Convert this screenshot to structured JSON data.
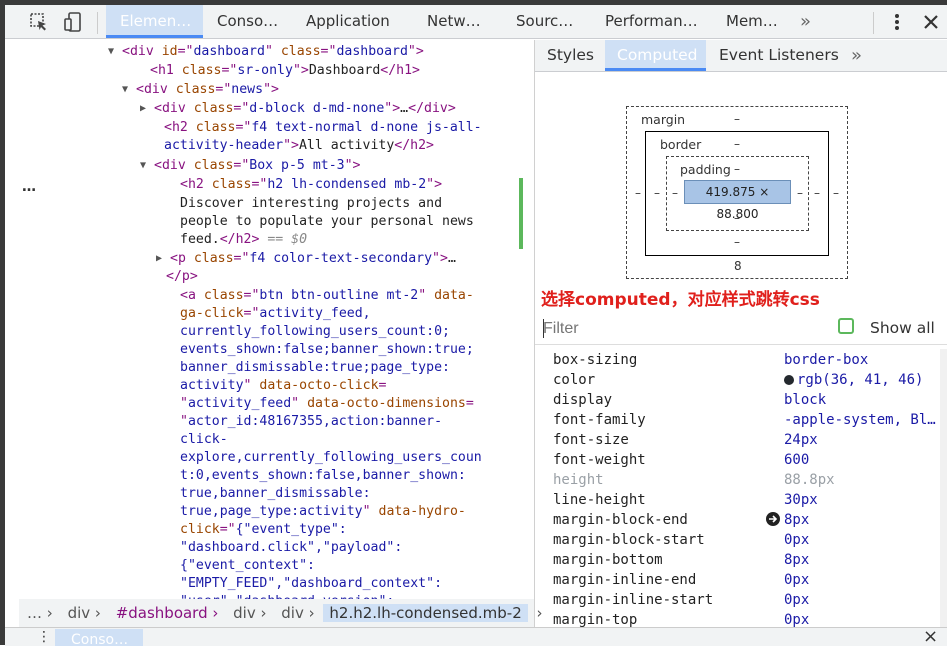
{
  "toolbar": {
    "tabs": [
      "Elemen…",
      "Conso…",
      "Application",
      "Netw…",
      "Sourc…",
      "Performan…",
      "Mem…"
    ],
    "more_label": "»"
  },
  "tree": {
    "lines": [
      [
        {
          "c": "tag",
          "t": "<div "
        },
        {
          "c": "attr",
          "t": "id"
        },
        {
          "c": "tag",
          "t": "=\""
        },
        {
          "c": "val",
          "t": "dashboard"
        },
        {
          "c": "tag",
          "t": "\" "
        },
        {
          "c": "attr",
          "t": "class"
        },
        {
          "c": "tag",
          "t": "=\""
        },
        {
          "c": "val",
          "t": "dashboard"
        },
        {
          "c": "tag",
          "t": "\">"
        }
      ],
      [
        {
          "c": "tag",
          "t": "<h1 "
        },
        {
          "c": "attr",
          "t": "class"
        },
        {
          "c": "tag",
          "t": "=\""
        },
        {
          "c": "val",
          "t": "sr-only"
        },
        {
          "c": "tag",
          "t": "\">"
        },
        {
          "c": "txt",
          "t": "Dashboard"
        },
        {
          "c": "tag",
          "t": "</h1>"
        }
      ],
      [
        {
          "c": "tag",
          "t": "<div "
        },
        {
          "c": "attr",
          "t": "class"
        },
        {
          "c": "tag",
          "t": "=\""
        },
        {
          "c": "val",
          "t": "news"
        },
        {
          "c": "tag",
          "t": "\">"
        }
      ],
      [
        {
          "c": "tag",
          "t": "<div "
        },
        {
          "c": "attr",
          "t": "class"
        },
        {
          "c": "tag",
          "t": "=\""
        },
        {
          "c": "val",
          "t": "d-block d-md-none"
        },
        {
          "c": "tag",
          "t": "\">"
        },
        {
          "c": "txt",
          "t": "…"
        },
        {
          "c": "tag",
          "t": "</div>"
        }
      ],
      [
        {
          "c": "tag",
          "t": "<h2 "
        },
        {
          "c": "attr",
          "t": "class"
        },
        {
          "c": "tag",
          "t": "=\""
        },
        {
          "c": "val",
          "t": "f4 text-normal d-none js-all-"
        }
      ],
      [
        {
          "c": "val",
          "t": "activity-header"
        },
        {
          "c": "tag",
          "t": "\">"
        },
        {
          "c": "txt",
          "t": "All activity"
        },
        {
          "c": "tag",
          "t": "</h2>"
        }
      ],
      [
        {
          "c": "tag",
          "t": "<div "
        },
        {
          "c": "attr",
          "t": "class"
        },
        {
          "c": "tag",
          "t": "=\""
        },
        {
          "c": "val",
          "t": "Box p-5 mt-3"
        },
        {
          "c": "tag",
          "t": "\">"
        }
      ],
      [
        {
          "c": "tag",
          "t": "<h2 "
        },
        {
          "c": "attr",
          "t": "class"
        },
        {
          "c": "tag",
          "t": "=\""
        },
        {
          "c": "val",
          "t": "h2 lh-condensed mb-2"
        },
        {
          "c": "tag",
          "t": "\">"
        }
      ],
      [
        {
          "c": "txt",
          "t": "Discover interesting projects and"
        }
      ],
      [
        {
          "c": "txt",
          "t": "people to populate your personal news"
        }
      ],
      [
        {
          "c": "txt",
          "t": "feed."
        },
        {
          "c": "tag",
          "t": "</h2>"
        },
        {
          "c": "dim",
          "t": " == $0"
        }
      ],
      [
        {
          "c": "tag",
          "t": "<p "
        },
        {
          "c": "attr",
          "t": "class"
        },
        {
          "c": "tag",
          "t": "=\""
        },
        {
          "c": "val",
          "t": "f4 color-text-secondary"
        },
        {
          "c": "tag",
          "t": "\">"
        },
        {
          "c": "txt",
          "t": "…"
        }
      ],
      [
        {
          "c": "tag",
          "t": "</p>"
        }
      ],
      [
        {
          "c": "tag",
          "t": "<a "
        },
        {
          "c": "attr",
          "t": "class"
        },
        {
          "c": "tag",
          "t": "=\""
        },
        {
          "c": "val",
          "t": "btn btn-outline mt-2"
        },
        {
          "c": "tag",
          "t": "\" "
        },
        {
          "c": "attr",
          "t": "data-"
        }
      ],
      [
        {
          "c": "attr",
          "t": "ga-click"
        },
        {
          "c": "tag",
          "t": "=\""
        },
        {
          "c": "val",
          "t": "activity_feed,"
        }
      ],
      [
        {
          "c": "val",
          "t": "currently_following_users_count:0;"
        }
      ],
      [
        {
          "c": "val",
          "t": "events_shown:false;banner_shown:true;"
        }
      ],
      [
        {
          "c": "val",
          "t": "banner_dismissable:true;page_type:"
        }
      ],
      [
        {
          "c": "val",
          "t": "activity"
        },
        {
          "c": "tag",
          "t": "\" "
        },
        {
          "c": "attr",
          "t": "data-octo-click"
        },
        {
          "c": "tag",
          "t": "="
        }
      ],
      [
        {
          "c": "tag",
          "t": "\""
        },
        {
          "c": "val",
          "t": "activity_feed"
        },
        {
          "c": "tag",
          "t": "\" "
        },
        {
          "c": "attr",
          "t": "data-octo-dimensions"
        },
        {
          "c": "tag",
          "t": "="
        }
      ],
      [
        {
          "c": "tag",
          "t": "\""
        },
        {
          "c": "val",
          "t": "actor_id:48167355,action:banner-"
        }
      ],
      [
        {
          "c": "val",
          "t": "click-"
        }
      ],
      [
        {
          "c": "val",
          "t": "explore,currently_following_users_coun"
        }
      ],
      [
        {
          "c": "val",
          "t": "t:0,events_shown:false,banner_shown:"
        }
      ],
      [
        {
          "c": "val",
          "t": "true,banner_dismissable:"
        }
      ],
      [
        {
          "c": "val",
          "t": "true,page_type:activity"
        },
        {
          "c": "tag",
          "t": "\" "
        },
        {
          "c": "attr",
          "t": "data-hydro-"
        }
      ],
      [
        {
          "c": "attr",
          "t": "click"
        },
        {
          "c": "tag",
          "t": "=\""
        },
        {
          "c": "val",
          "t": "{\"event_type\":"
        }
      ],
      [
        {
          "c": "val",
          "t": "\"dashboard.click\",\"payload\":"
        }
      ],
      [
        {
          "c": "val",
          "t": "{\"event_context\":"
        }
      ],
      [
        {
          "c": "val",
          "t": "\"EMPTY_FEED\",\"dashboard_context\":"
        }
      ],
      [
        {
          "c": "val",
          "t": "\"user\",\"dashboard_version\":"
        }
      ]
    ],
    "ellipsis": "…"
  },
  "breadcrumb": {
    "items": [
      "… ›",
      "div ›",
      "#dashboard ›",
      "div ›",
      "div ›"
    ],
    "selected": "h2.h2.lh-condensed.mb-2",
    "trailing": "›"
  },
  "drawer": {
    "tab": "Conso…",
    "close": "×"
  },
  "subtabs": {
    "tabs": [
      "Styles",
      "Computed",
      "Event Listeners"
    ],
    "more": "»"
  },
  "boxmodel": {
    "margin_label": "margin",
    "border_label": "border",
    "padding_label": "padding",
    "content_size": "419.875 × 88.800",
    "dash": "–",
    "margin_bottom": "8"
  },
  "annotation": "选择computed，对应样式跳转css",
  "filter": {
    "placeholder": "Filter",
    "show_all_label": "Show all"
  },
  "computed": {
    "props": [
      {
        "name": "box-sizing",
        "value": "border-box"
      },
      {
        "name": "color",
        "value": "rgb(36, 41, 46)"
      },
      {
        "name": "display",
        "value": "block"
      },
      {
        "name": "font-family",
        "value": "-apple-system, Bl…"
      },
      {
        "name": "font-size",
        "value": "24px"
      },
      {
        "name": "font-weight",
        "value": "600"
      },
      {
        "name": "height",
        "value": "88.8px"
      },
      {
        "name": "line-height",
        "value": "30px"
      },
      {
        "name": "margin-block-end",
        "value": "8px"
      },
      {
        "name": "margin-block-start",
        "value": "0px"
      },
      {
        "name": "margin-bottom",
        "value": "8px"
      },
      {
        "name": "margin-inline-end",
        "value": "0px"
      },
      {
        "name": "margin-inline-start",
        "value": "0px"
      },
      {
        "name": "margin-top",
        "value": "0px"
      }
    ]
  },
  "colors": {
    "accent": "#4a8af4",
    "selection": "#cfe0f5",
    "annotation": "#e0201c",
    "checkbox": "#5cb85c"
  }
}
